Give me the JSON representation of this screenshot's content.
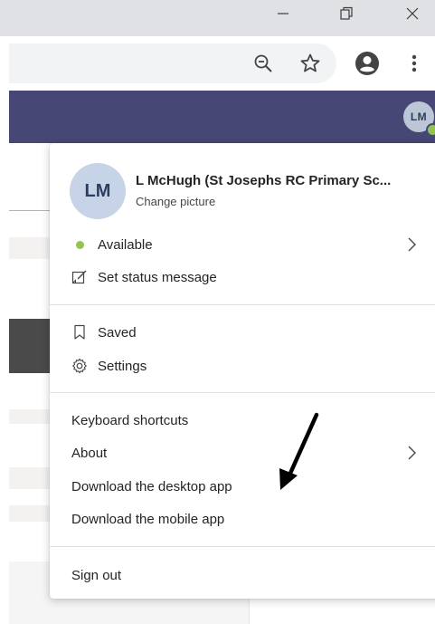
{
  "window": {
    "minimize_glyph": "—",
    "maximize_glyph": "⧉",
    "close_glyph": "✕"
  },
  "toolbar": {
    "icons": [
      "zoom-out-icon",
      "bookmark-star-icon",
      "account-icon",
      "more-menu-icon"
    ]
  },
  "header": {
    "avatar_initials": "LM",
    "status_color": "#92c353",
    "bar_color": "#464775"
  },
  "profile": {
    "initials": "LM",
    "name": "L McHugh (St Josephs RC Primary Sc...",
    "change_picture": "Change picture"
  },
  "menu": {
    "status": "Available",
    "set_status": "Set status message",
    "saved": "Saved",
    "settings": "Settings",
    "keyboard_shortcuts": "Keyboard shortcuts",
    "about": "About",
    "download_desktop": "Download the desktop app",
    "download_mobile": "Download the mobile app",
    "sign_out": "Sign out"
  }
}
